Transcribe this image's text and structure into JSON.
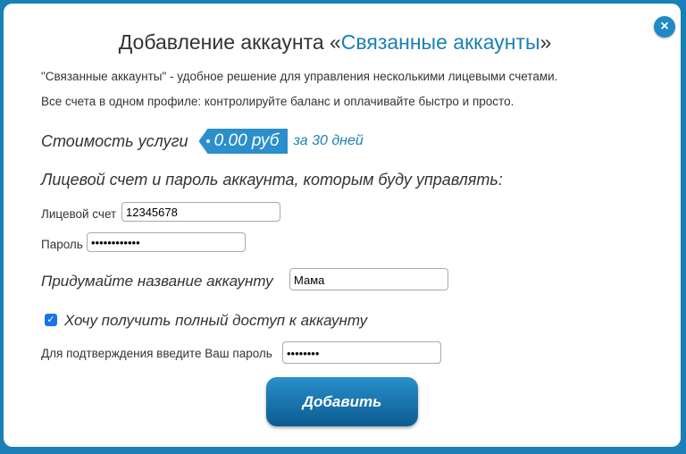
{
  "dialog": {
    "close_label": "×",
    "title_prefix": "Добавление аккаунта «",
    "title_accent": "Связанные аккаунты",
    "title_suffix": "»",
    "description_1": "\"Связанные аккаунты\" - удобное решение для управления несколькими лицевыми счетами.",
    "description_2": "Все счета в одном профиле: контролируйте баланс и оплачивайте быстро и просто.",
    "price_label": "Стоимость услуги",
    "price_value": "0.00 руб",
    "price_period": "за 30 дней",
    "section_heading": "Лицевой счет и пароль аккаунта, которым буду управлять:",
    "account_label": "Лицевой счет",
    "account_value": "12345678",
    "password_label": "Пароль",
    "password_value": "••••••••••••",
    "name_label": "Придумайте название аккаунту",
    "name_value": "Мама",
    "full_access_label": "Хочу получить полный доступ к аккаунту",
    "full_access_checked": true,
    "confirm_label": "Для подтверждения введите Ваш пароль",
    "confirm_value": "••••••••",
    "submit_label": "Добавить"
  },
  "colors": {
    "accent": "#1a7fb6",
    "button": "#0b6aa5",
    "background": "#1a7fb6"
  }
}
